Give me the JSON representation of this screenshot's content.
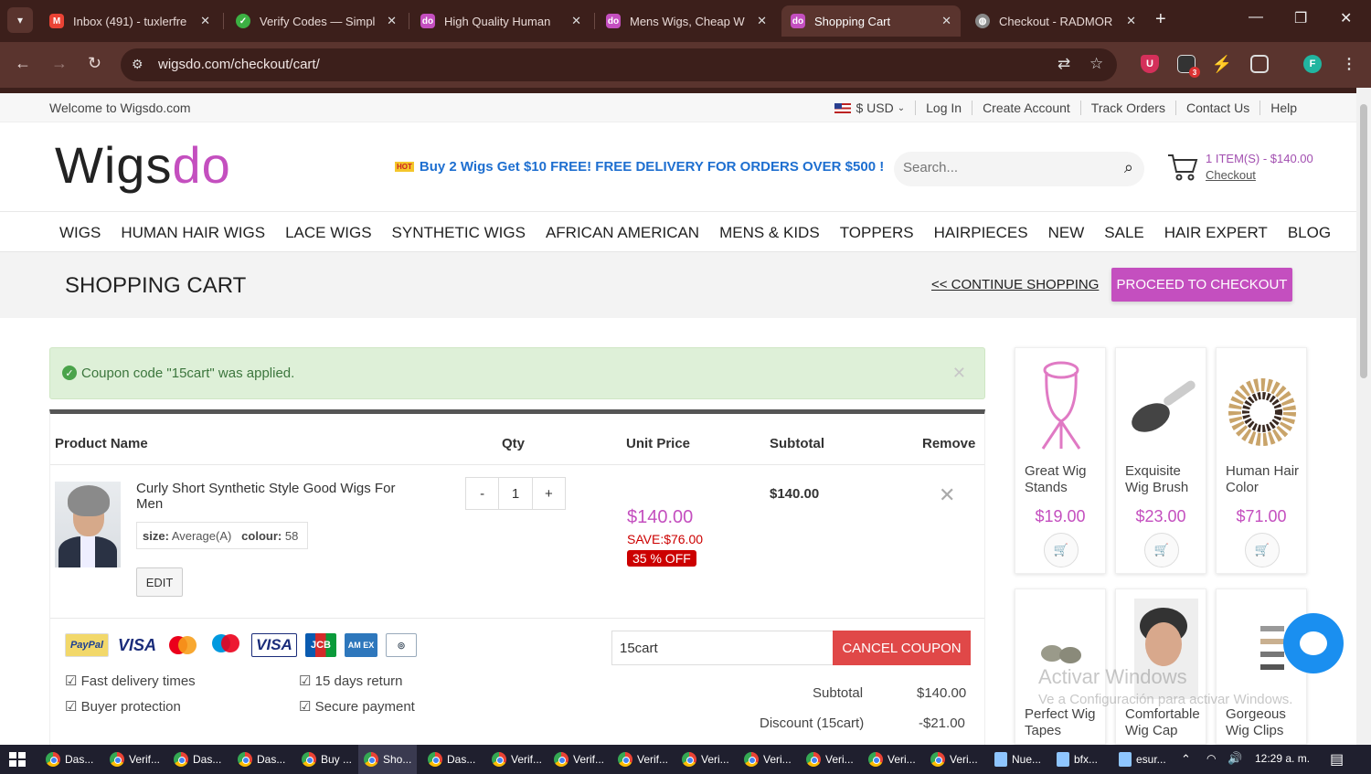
{
  "browser": {
    "tabs": [
      {
        "label": "Inbox (491) - tuxlerfre",
        "icon": "gmail-icon",
        "color": "#ea4335"
      },
      {
        "label": "Verify Codes — Simpl",
        "icon": "check-icon",
        "color": "#3cb043"
      },
      {
        "label": "High Quality Human",
        "icon": "wigsdo-icon",
        "color": "#c44fbf"
      },
      {
        "label": "Mens Wigs, Cheap W",
        "icon": "wigsdo-icon",
        "color": "#c44fbf"
      },
      {
        "label": "Shopping Cart",
        "icon": "wigsdo-icon",
        "color": "#c44fbf",
        "active": true
      },
      {
        "label": "Checkout - RADMOR",
        "icon": "globe-icon",
        "color": "#888888"
      }
    ],
    "url": "wigsdo.com/checkout/cart/",
    "ext_badge": "3",
    "profile_letter": "F"
  },
  "topbar": {
    "welcome": "Welcome to Wigsdo.com",
    "currency": "$ USD",
    "links": [
      "Log In",
      "Create Account",
      "Track Orders",
      "Contact Us",
      "Help"
    ]
  },
  "header": {
    "logo_part1": "Wigs",
    "logo_part2": "do",
    "hot_badge": "HOT",
    "promo": "Buy 2 Wigs Get $10 FREE! FREE DELIVERY FOR ORDERS OVER $500 !",
    "search_placeholder": "Search...",
    "cart_summary": "1 ITEM(S) - $140.00",
    "cart_checkout": "Checkout"
  },
  "nav": [
    "WIGS",
    "HUMAN HAIR WIGS",
    "LACE WIGS",
    "SYNTHETIC WIGS",
    "AFRICAN AMERICAN",
    "MENS & KIDS",
    "TOPPERS",
    "HAIRPIECES",
    "NEW",
    "SALE",
    "HAIR EXPERT",
    "BLOG"
  ],
  "cart_page": {
    "title": "SHOPPING CART",
    "continue": "<< CONTINUE SHOPPING",
    "proceed": "PROCEED TO CHECKOUT",
    "alert": "Coupon code \"15cart\" was applied.",
    "headers": {
      "product": "Product Name",
      "qty": "Qty",
      "unit": "Unit Price",
      "subtotal": "Subtotal",
      "remove": "Remove"
    },
    "item": {
      "name": "Curly Short Synthetic Style Good Wigs For Men",
      "size_label": "size:",
      "size": "Average(A)",
      "colour_label": "colour:",
      "colour": "58",
      "edit": "EDIT",
      "qty": "1",
      "qty_minus": "-",
      "qty_plus": "+",
      "price": "$140.00",
      "save": "SAVE:$76.00",
      "off": "35 % OFF",
      "subtotal": "$140.00"
    },
    "payments": [
      "PayPal",
      "VISA",
      "Mastercard",
      "Maestro",
      "VISA Electron",
      "JCB",
      "American Express",
      "Diners Club"
    ],
    "features": [
      "Fast delivery times",
      "15 days return",
      "Buyer protection",
      "Secure payment"
    ],
    "coupon_value": "15cart",
    "cancel_coupon": "CANCEL COUPON",
    "totals": [
      {
        "label": "Subtotal",
        "value": "$140.00"
      },
      {
        "label": "Discount (15cart)",
        "value": "-$21.00"
      }
    ]
  },
  "sidebar": {
    "products": [
      {
        "name": "Great Wig Stands",
        "price": "$19.00"
      },
      {
        "name": "Exquisite Wig Brush",
        "price": "$23.00"
      },
      {
        "name": "Human Hair Color",
        "price": "$71.00"
      },
      {
        "name": "Perfect Wig Tapes",
        "price": ""
      },
      {
        "name": "Comfortable Wig Cap",
        "price": ""
      },
      {
        "name": "Gorgeous Wig Clips",
        "price": ""
      }
    ]
  },
  "watermark": {
    "line1": "Activar Windows",
    "line2": "Ve a Configuración para activar Windows."
  },
  "taskbar": {
    "items": [
      "Das...",
      "Verif...",
      "Das...",
      "Das...",
      "Buy ...",
      "Sho...",
      "Das...",
      "Verif...",
      "Verif...",
      "Verif...",
      "Veri...",
      "Veri...",
      "Veri...",
      "Veri...",
      "Veri...",
      "Nue...",
      "bfx...",
      "esur..."
    ],
    "clock": "12:29 a. m."
  },
  "colors": {
    "brand": "#c44fbf",
    "promo": "#1e6fd0",
    "alert_bg": "#def0d8",
    "cancel": "#e04848",
    "chat": "#1a8ff0"
  }
}
